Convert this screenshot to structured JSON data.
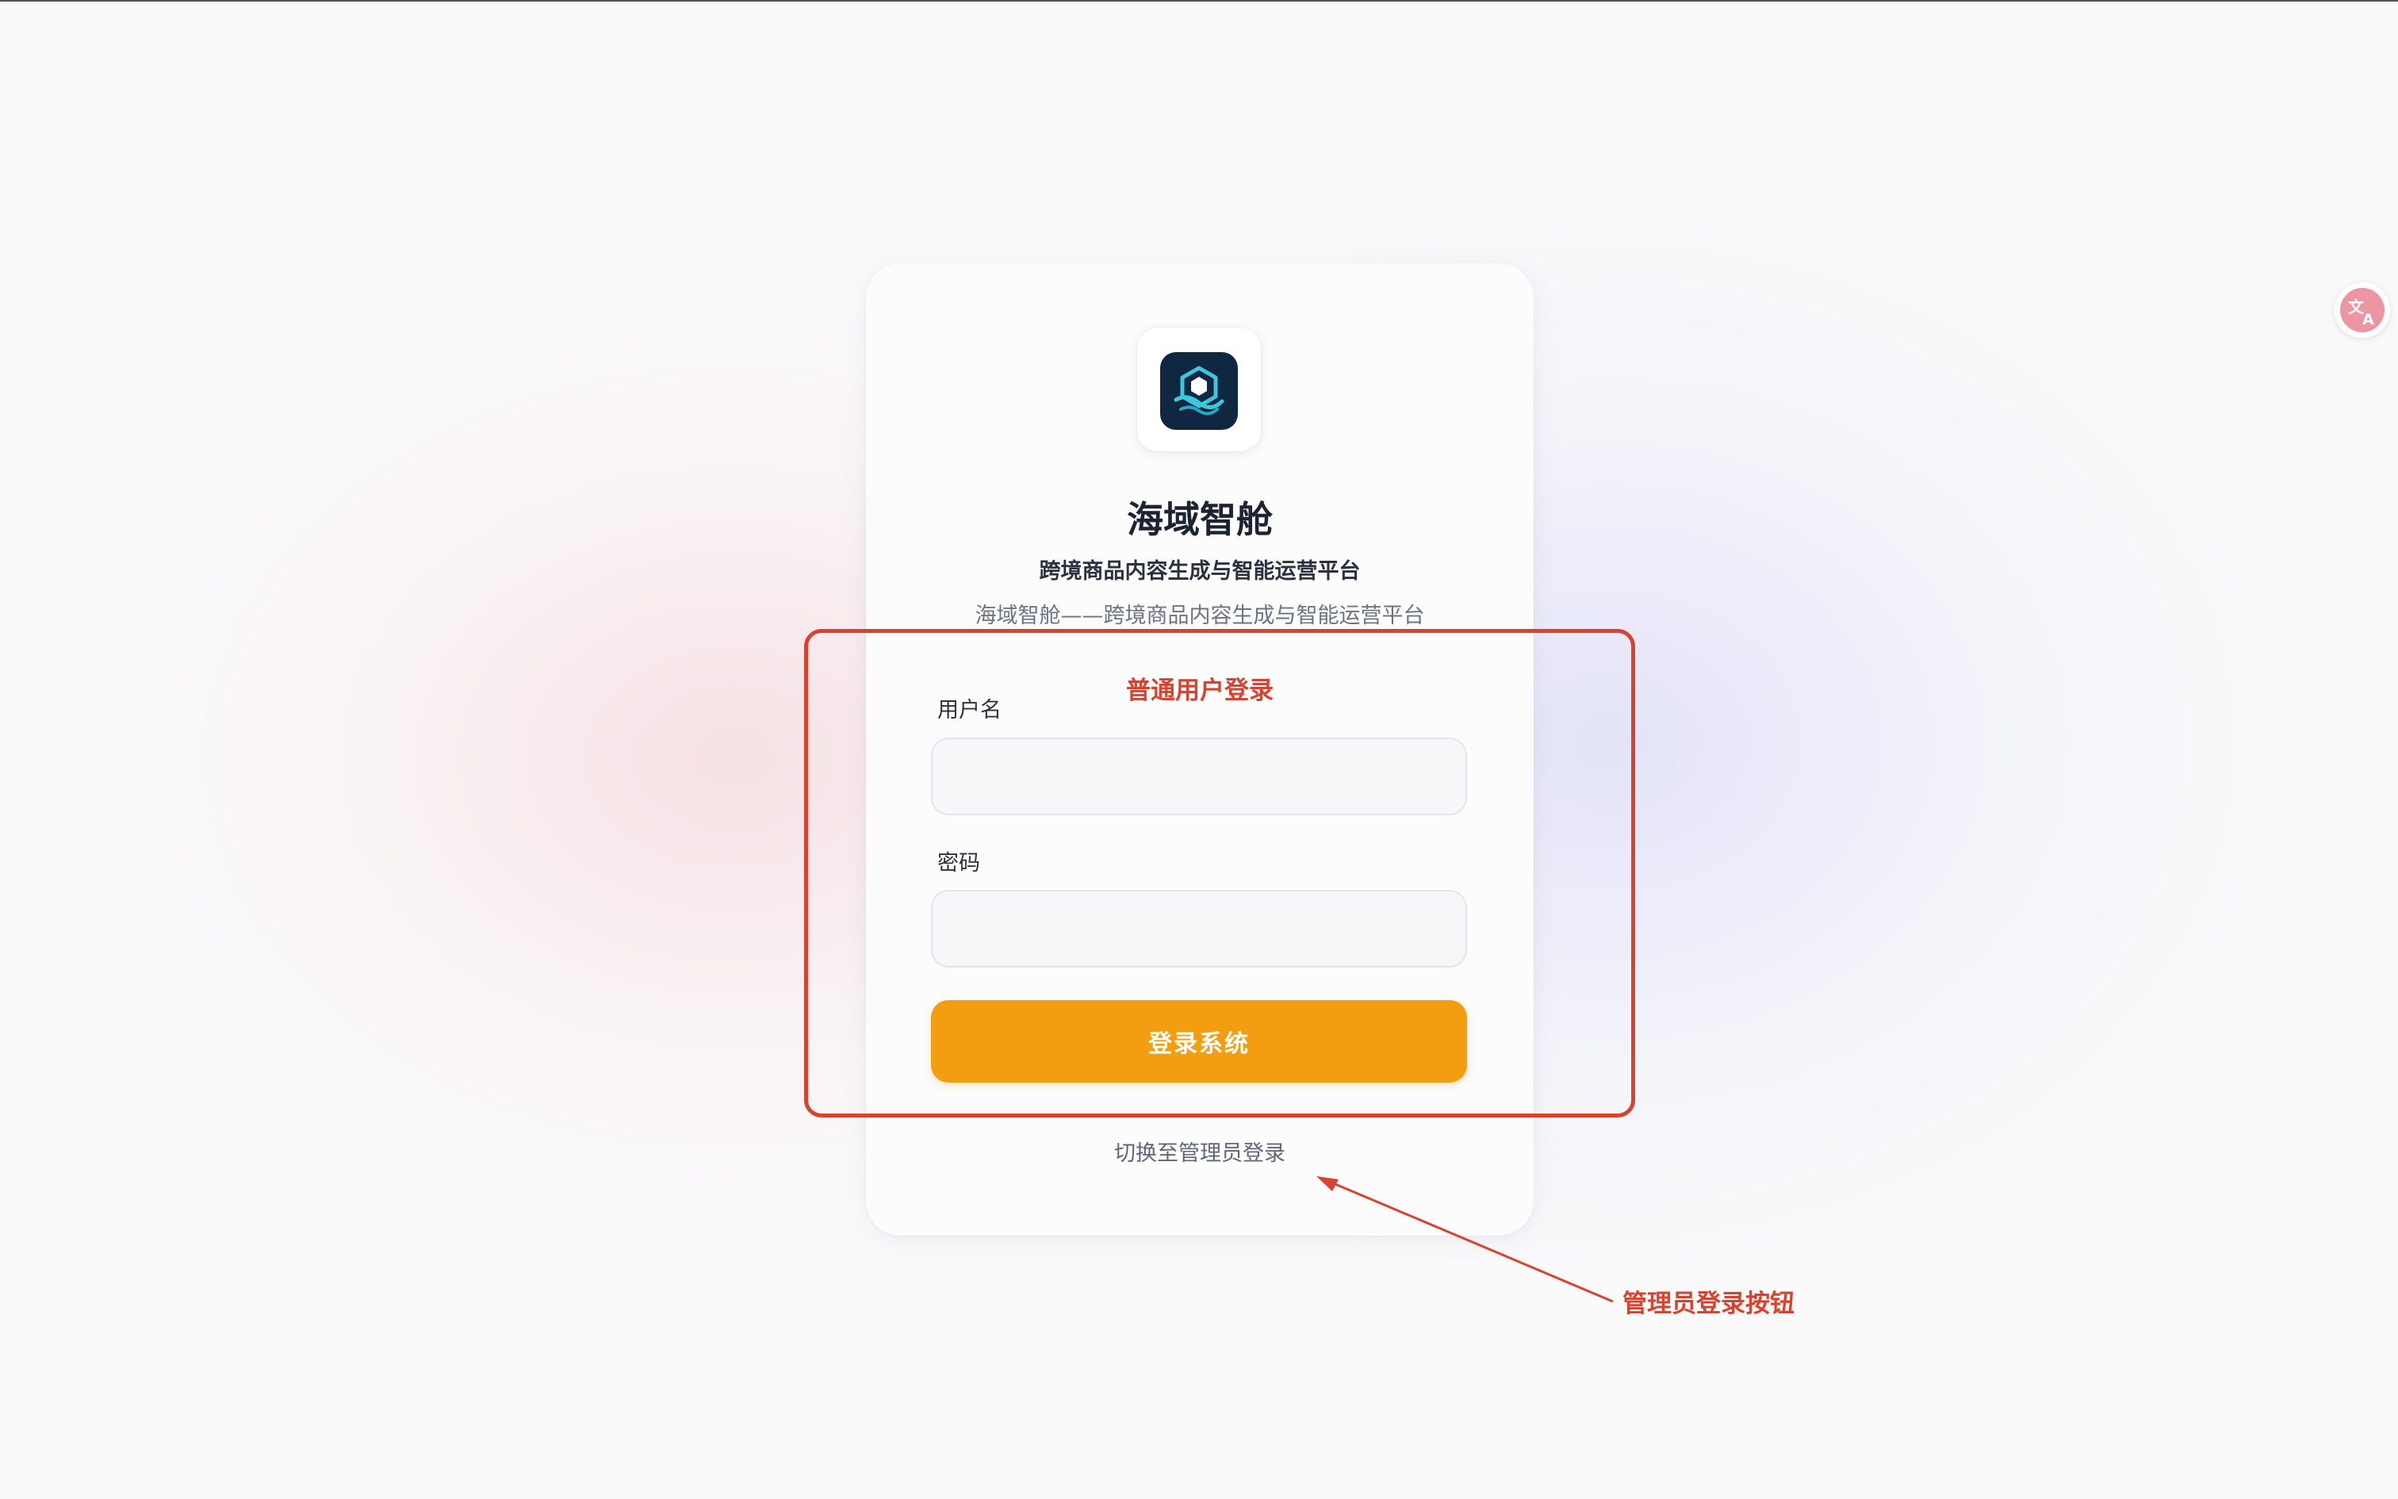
{
  "app": {
    "name": "海域智舱",
    "subtitle": "跨境商品内容生成与智能运营平台",
    "tagline": "海域智舱——跨境商品内容生成与智能运营平台",
    "logo_icon": "cube-wave-icon"
  },
  "login_form": {
    "username_label": "用户名",
    "username_value": "",
    "username_placeholder": "",
    "password_label": "密码",
    "password_value": "",
    "password_placeholder": "",
    "submit_label": "登录系统",
    "submit_color": "#f39e11"
  },
  "switch_link": {
    "label": "切换至管理员登录"
  },
  "annotations": {
    "box_title": "普通用户登录",
    "arrow_label": "管理员登录按钮",
    "color": "#d8432f"
  },
  "floating": {
    "translate_icon": "translate-icon"
  }
}
